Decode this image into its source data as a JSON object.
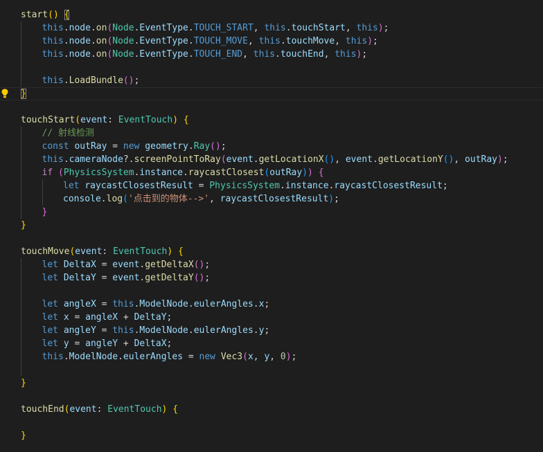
{
  "editor": {
    "lines": [
      {
        "indent": 0,
        "tokens": [
          [
            "start",
            "fn"
          ],
          [
            "(",
            "b1"
          ],
          [
            ")",
            "b1"
          ],
          [
            " ",
            "pun"
          ],
          [
            "{",
            "b1",
            "boxed"
          ]
        ]
      },
      {
        "indent": 1,
        "tokens": [
          [
            "this",
            "kw"
          ],
          [
            ".",
            "pun"
          ],
          [
            "node",
            "var"
          ],
          [
            ".",
            "pun"
          ],
          [
            "on",
            "fn"
          ],
          [
            "(",
            "b2"
          ],
          [
            "Node",
            "type"
          ],
          [
            ".",
            "pun"
          ],
          [
            "EventType",
            "var"
          ],
          [
            ".",
            "pun"
          ],
          [
            "TOUCH_START",
            "kw"
          ],
          [
            ", ",
            "pun"
          ],
          [
            "this",
            "kw"
          ],
          [
            ".",
            "pun"
          ],
          [
            "touchStart",
            "var"
          ],
          [
            ", ",
            "pun"
          ],
          [
            "this",
            "kw"
          ],
          [
            ")",
            "b2"
          ],
          [
            ";",
            "pun"
          ]
        ]
      },
      {
        "indent": 1,
        "tokens": [
          [
            "this",
            "kw"
          ],
          [
            ".",
            "pun"
          ],
          [
            "node",
            "var"
          ],
          [
            ".",
            "pun"
          ],
          [
            "on",
            "fn"
          ],
          [
            "(",
            "b2"
          ],
          [
            "Node",
            "type"
          ],
          [
            ".",
            "pun"
          ],
          [
            "EventType",
            "var"
          ],
          [
            ".",
            "pun"
          ],
          [
            "TOUCH_MOVE",
            "kw"
          ],
          [
            ", ",
            "pun"
          ],
          [
            "this",
            "kw"
          ],
          [
            ".",
            "pun"
          ],
          [
            "touchMove",
            "var"
          ],
          [
            ", ",
            "pun"
          ],
          [
            "this",
            "kw"
          ],
          [
            ")",
            "b2"
          ],
          [
            ";",
            "pun"
          ]
        ]
      },
      {
        "indent": 1,
        "tokens": [
          [
            "this",
            "kw"
          ],
          [
            ".",
            "pun"
          ],
          [
            "node",
            "var"
          ],
          [
            ".",
            "pun"
          ],
          [
            "on",
            "fn"
          ],
          [
            "(",
            "b2"
          ],
          [
            "Node",
            "type"
          ],
          [
            ".",
            "pun"
          ],
          [
            "EventType",
            "var"
          ],
          [
            ".",
            "pun"
          ],
          [
            "TOUCH_END",
            "kw"
          ],
          [
            ", ",
            "pun"
          ],
          [
            "this",
            "kw"
          ],
          [
            ".",
            "pun"
          ],
          [
            "touchEnd",
            "var"
          ],
          [
            ", ",
            "pun"
          ],
          [
            "this",
            "kw"
          ],
          [
            ")",
            "b2"
          ],
          [
            ";",
            "pun"
          ]
        ]
      },
      {
        "indent": 1,
        "tokens": []
      },
      {
        "indent": 1,
        "tokens": [
          [
            "this",
            "kw"
          ],
          [
            ".",
            "pun"
          ],
          [
            "LoadBundle",
            "fn"
          ],
          [
            "(",
            "b2"
          ],
          [
            ")",
            "b2"
          ],
          [
            ";",
            "pun"
          ]
        ]
      },
      {
        "indent": 0,
        "current": true,
        "lightbulb": true,
        "tokens": [
          [
            "}",
            "b1",
            "boxed"
          ]
        ]
      },
      {
        "indent": 0,
        "tokens": []
      },
      {
        "indent": 0,
        "tokens": [
          [
            "touchStart",
            "fn"
          ],
          [
            "(",
            "b1"
          ],
          [
            "event",
            "var"
          ],
          [
            ": ",
            "pun"
          ],
          [
            "EventTouch",
            "type"
          ],
          [
            ")",
            "b1"
          ],
          [
            " ",
            "pun"
          ],
          [
            "{",
            "b1"
          ]
        ]
      },
      {
        "indent": 1,
        "tokens": [
          [
            "// 射线检测",
            "cmt"
          ]
        ]
      },
      {
        "indent": 1,
        "tokens": [
          [
            "const",
            "kw"
          ],
          [
            " ",
            "pun"
          ],
          [
            "outRay",
            "var"
          ],
          [
            " = ",
            "pun"
          ],
          [
            "new",
            "kw"
          ],
          [
            " ",
            "pun"
          ],
          [
            "geometry",
            "var"
          ],
          [
            ".",
            "pun"
          ],
          [
            "Ray",
            "type"
          ],
          [
            "(",
            "b2"
          ],
          [
            ")",
            "b2"
          ],
          [
            ";",
            "pun"
          ]
        ]
      },
      {
        "indent": 1,
        "tokens": [
          [
            "this",
            "kw"
          ],
          [
            ".",
            "pun"
          ],
          [
            "cameraNode",
            "var"
          ],
          [
            "?.",
            "pun"
          ],
          [
            "screenPointToRay",
            "fn"
          ],
          [
            "(",
            "b2"
          ],
          [
            "event",
            "var"
          ],
          [
            ".",
            "pun"
          ],
          [
            "getLocationX",
            "fn"
          ],
          [
            "(",
            "b3"
          ],
          [
            ")",
            "b3"
          ],
          [
            ", ",
            "pun"
          ],
          [
            "event",
            "var"
          ],
          [
            ".",
            "pun"
          ],
          [
            "getLocationY",
            "fn"
          ],
          [
            "(",
            "b3"
          ],
          [
            ")",
            "b3"
          ],
          [
            ", ",
            "pun"
          ],
          [
            "outRay",
            "var"
          ],
          [
            ")",
            "b2"
          ],
          [
            ";",
            "pun"
          ]
        ]
      },
      {
        "indent": 1,
        "tokens": [
          [
            "if",
            "ctl"
          ],
          [
            " ",
            "pun"
          ],
          [
            "(",
            "b2"
          ],
          [
            "PhysicsSystem",
            "type"
          ],
          [
            ".",
            "pun"
          ],
          [
            "instance",
            "var"
          ],
          [
            ".",
            "pun"
          ],
          [
            "raycastClosest",
            "fn"
          ],
          [
            "(",
            "b3"
          ],
          [
            "outRay",
            "var"
          ],
          [
            ")",
            "b3"
          ],
          [
            ")",
            "b2"
          ],
          [
            " ",
            "pun"
          ],
          [
            "{",
            "b2"
          ]
        ]
      },
      {
        "indent": 2,
        "tokens": [
          [
            "let",
            "kw"
          ],
          [
            " ",
            "pun"
          ],
          [
            "raycastClosestResult",
            "var"
          ],
          [
            " = ",
            "pun"
          ],
          [
            "PhysicsSystem",
            "type"
          ],
          [
            ".",
            "pun"
          ],
          [
            "instance",
            "var"
          ],
          [
            ".",
            "pun"
          ],
          [
            "raycastClosestResult",
            "var"
          ],
          [
            ";",
            "pun"
          ]
        ]
      },
      {
        "indent": 2,
        "tokens": [
          [
            "console",
            "var"
          ],
          [
            ".",
            "pun"
          ],
          [
            "log",
            "fn"
          ],
          [
            "(",
            "b3"
          ],
          [
            "'点击到的物体-->'",
            "str"
          ],
          [
            ", ",
            "pun"
          ],
          [
            "raycastClosestResult",
            "var"
          ],
          [
            ")",
            "b3"
          ],
          [
            ";",
            "pun"
          ]
        ]
      },
      {
        "indent": 1,
        "tokens": [
          [
            "}",
            "b2"
          ]
        ]
      },
      {
        "indent": 0,
        "tokens": [
          [
            "}",
            "b1"
          ]
        ]
      },
      {
        "indent": 0,
        "tokens": []
      },
      {
        "indent": 0,
        "tokens": [
          [
            "touchMove",
            "fn"
          ],
          [
            "(",
            "b1"
          ],
          [
            "event",
            "var"
          ],
          [
            ": ",
            "pun"
          ],
          [
            "EventTouch",
            "type"
          ],
          [
            ")",
            "b1"
          ],
          [
            " ",
            "pun"
          ],
          [
            "{",
            "b1"
          ]
        ]
      },
      {
        "indent": 1,
        "tokens": [
          [
            "let",
            "kw"
          ],
          [
            " ",
            "pun"
          ],
          [
            "DeltaX",
            "var"
          ],
          [
            " = ",
            "pun"
          ],
          [
            "event",
            "var"
          ],
          [
            ".",
            "pun"
          ],
          [
            "getDeltaX",
            "fn"
          ],
          [
            "(",
            "b2"
          ],
          [
            ")",
            "b2"
          ],
          [
            ";",
            "pun"
          ]
        ]
      },
      {
        "indent": 1,
        "tokens": [
          [
            "let",
            "kw"
          ],
          [
            " ",
            "pun"
          ],
          [
            "DeltaY",
            "var"
          ],
          [
            " = ",
            "pun"
          ],
          [
            "event",
            "var"
          ],
          [
            ".",
            "pun"
          ],
          [
            "getDeltaY",
            "fn"
          ],
          [
            "(",
            "b2"
          ],
          [
            ")",
            "b2"
          ],
          [
            ";",
            "pun"
          ]
        ]
      },
      {
        "indent": 1,
        "tokens": []
      },
      {
        "indent": 1,
        "tokens": [
          [
            "let",
            "kw"
          ],
          [
            " ",
            "pun"
          ],
          [
            "angleX",
            "var"
          ],
          [
            " = ",
            "pun"
          ],
          [
            "this",
            "kw"
          ],
          [
            ".",
            "pun"
          ],
          [
            "ModelNode",
            "var"
          ],
          [
            ".",
            "pun"
          ],
          [
            "eulerAngles",
            "var"
          ],
          [
            ".",
            "pun"
          ],
          [
            "x",
            "var"
          ],
          [
            ";",
            "pun"
          ]
        ]
      },
      {
        "indent": 1,
        "tokens": [
          [
            "let",
            "kw"
          ],
          [
            " ",
            "pun"
          ],
          [
            "x",
            "var"
          ],
          [
            " = ",
            "pun"
          ],
          [
            "angleX",
            "var"
          ],
          [
            " + ",
            "pun"
          ],
          [
            "DeltaY",
            "var"
          ],
          [
            ";",
            "pun"
          ]
        ]
      },
      {
        "indent": 1,
        "tokens": [
          [
            "let",
            "kw"
          ],
          [
            " ",
            "pun"
          ],
          [
            "angleY",
            "var"
          ],
          [
            " = ",
            "pun"
          ],
          [
            "this",
            "kw"
          ],
          [
            ".",
            "pun"
          ],
          [
            "ModelNode",
            "var"
          ],
          [
            ".",
            "pun"
          ],
          [
            "eulerAngles",
            "var"
          ],
          [
            ".",
            "pun"
          ],
          [
            "y",
            "var"
          ],
          [
            ";",
            "pun"
          ]
        ]
      },
      {
        "indent": 1,
        "tokens": [
          [
            "let",
            "kw"
          ],
          [
            " ",
            "pun"
          ],
          [
            "y",
            "var"
          ],
          [
            " = ",
            "pun"
          ],
          [
            "angleY",
            "var"
          ],
          [
            " + ",
            "pun"
          ],
          [
            "DeltaX",
            "var"
          ],
          [
            ";",
            "pun"
          ]
        ]
      },
      {
        "indent": 1,
        "tokens": [
          [
            "this",
            "kw"
          ],
          [
            ".",
            "pun"
          ],
          [
            "ModelNode",
            "var"
          ],
          [
            ".",
            "pun"
          ],
          [
            "eulerAngles",
            "var"
          ],
          [
            " = ",
            "pun"
          ],
          [
            "new",
            "kw"
          ],
          [
            " ",
            "pun"
          ],
          [
            "Vec3",
            "fn"
          ],
          [
            "(",
            "b2"
          ],
          [
            "x",
            "var"
          ],
          [
            ", ",
            "pun"
          ],
          [
            "y",
            "var"
          ],
          [
            ", ",
            "pun"
          ],
          [
            "0",
            "num"
          ],
          [
            ")",
            "b2"
          ],
          [
            ";",
            "pun"
          ]
        ]
      },
      {
        "indent": 1,
        "tokens": []
      },
      {
        "indent": 0,
        "tokens": [
          [
            "}",
            "b1"
          ]
        ]
      },
      {
        "indent": 0,
        "tokens": []
      },
      {
        "indent": 0,
        "tokens": [
          [
            "touchEnd",
            "fn"
          ],
          [
            "(",
            "b1"
          ],
          [
            "event",
            "var"
          ],
          [
            ": ",
            "pun"
          ],
          [
            "EventTouch",
            "type"
          ],
          [
            ")",
            "b1"
          ],
          [
            " ",
            "pun"
          ],
          [
            "{",
            "b1"
          ]
        ]
      },
      {
        "indent": 0,
        "tokens": []
      },
      {
        "indent": 0,
        "tokens": [
          [
            "}",
            "b1"
          ]
        ]
      }
    ]
  }
}
